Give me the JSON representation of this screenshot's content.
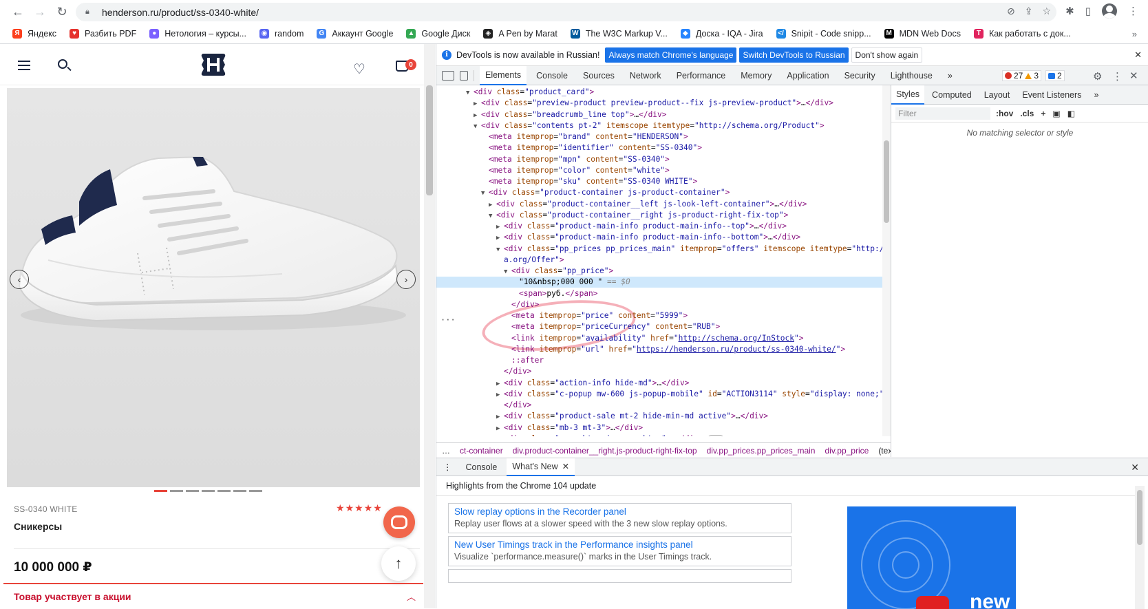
{
  "browser": {
    "url": "henderson.ru/product/ss-0340-white/",
    "bookmarks": [
      {
        "label": "Яндекс",
        "color": "#fc3f1d",
        "glyph": "Я"
      },
      {
        "label": "Разбить PDF",
        "color": "#e5322d",
        "glyph": "♥"
      },
      {
        "label": "Нетология – курсы...",
        "color": "#7b61ff",
        "glyph": "●"
      },
      {
        "label": "random",
        "color": "#5865f2",
        "glyph": "◉"
      },
      {
        "label": "Аккаунт Google",
        "color": "#4285f4",
        "glyph": "G"
      },
      {
        "label": "Google Диск",
        "color": "#34a853",
        "glyph": "▲"
      },
      {
        "label": "A Pen by Marat",
        "color": "#222222",
        "glyph": "◈"
      },
      {
        "label": "The W3C Markup V...",
        "color": "#005a9c",
        "glyph": "W"
      },
      {
        "label": "Доска - IQA - Jira",
        "color": "#2684ff",
        "glyph": "◆"
      },
      {
        "label": "Snipit - Code snipp...",
        "color": "#1e88e5",
        "glyph": "</"
      },
      {
        "label": "MDN Web Docs",
        "color": "#000000",
        "glyph": "M"
      },
      {
        "label": "Как работать с док...",
        "color": "#e0245e",
        "glyph": "T"
      }
    ]
  },
  "site": {
    "cart_count": "0",
    "sku": "SS-0340 WHITE",
    "product_type": "Сникерсы",
    "price": "10 000 000 ₽",
    "promo": "Товар участвует в акции",
    "rating": 4.5,
    "gallery_dots": 7,
    "gallery_active": 0
  },
  "devtools": {
    "info_message": "DevTools is now available in Russian!",
    "btn_match": "Always match Chrome's language",
    "btn_switch": "Switch DevTools to Russian",
    "btn_dismiss": "Don't show again",
    "tabs": [
      "Elements",
      "Console",
      "Sources",
      "Network",
      "Performance",
      "Memory",
      "Application",
      "Security",
      "Lighthouse"
    ],
    "errors": "27",
    "warnings": "3",
    "messages": "2",
    "breadcrumbs": [
      "ct-container",
      "div.product-container__right.js-product-right-fix-top",
      "div.pp_prices.pp_prices_main",
      "div.pp_price",
      "(text)"
    ],
    "styles_tabs": [
      "Styles",
      "Computed",
      "Layout",
      "Event Listeners"
    ],
    "filter_placeholder": "Filter",
    "hov": ":hov",
    "cls": ".cls",
    "no_match": "No matching selector or style",
    "drawer_tabs": [
      "Console",
      "What's New"
    ],
    "highlights": "Highlights from the Chrome 104 update",
    "cards": [
      {
        "title": "Slow replay options in the Recorder panel",
        "desc": "Replay user flows at a slower speed with the 3 new slow replay options."
      },
      {
        "title": "New User Timings track in the Performance insights panel",
        "desc": "Visualize `performance.measure()` marks in the User Timings track."
      }
    ],
    "video_text": "new"
  },
  "dom_lines": [
    {
      "indent": 3,
      "exp": "open",
      "html": "<span class=\"tg\">&lt;div</span> <span class=\"at\">class</span>=<span class=\"vl\">\"product_card\"</span><span class=\"tg\">&gt;</span>"
    },
    {
      "indent": 4,
      "exp": "closed",
      "html": "<span class=\"tg\">&lt;div</span> <span class=\"at\">class</span>=<span class=\"vl\">\"preview-product preview-product--fix js-preview-product\"</span><span class=\"tg\">&gt;</span>…<span class=\"tg\">&lt;/div&gt;</span>"
    },
    {
      "indent": 4,
      "exp": "closed",
      "html": "<span class=\"tg\">&lt;div</span> <span class=\"at\">class</span>=<span class=\"vl\">\"breadcrumb_line top\"</span><span class=\"tg\">&gt;</span>…<span class=\"tg\">&lt;/div&gt;</span>"
    },
    {
      "indent": 4,
      "exp": "open",
      "html": "<span class=\"tg\">&lt;div</span> <span class=\"at\">class</span>=<span class=\"vl\">\"contents pt-2\"</span> <span class=\"at\">itemscope</span> <span class=\"at\">itemtype</span>=<span class=\"vl\">\"http://schema.org/Product\"</span><span class=\"tg\">&gt;</span>"
    },
    {
      "indent": 5,
      "exp": "",
      "html": "<span class=\"tg\">&lt;meta</span> <span class=\"at\">itemprop</span>=<span class=\"vl\">\"brand\"</span> <span class=\"at\">content</span>=<span class=\"vl\">\"HENDERSON\"</span><span class=\"tg\">&gt;</span>"
    },
    {
      "indent": 5,
      "exp": "",
      "html": "<span class=\"tg\">&lt;meta</span> <span class=\"at\">itemprop</span>=<span class=\"vl\">\"identifier\"</span> <span class=\"at\">content</span>=<span class=\"vl\">\"SS-0340\"</span><span class=\"tg\">&gt;</span>"
    },
    {
      "indent": 5,
      "exp": "",
      "html": "<span class=\"tg\">&lt;meta</span> <span class=\"at\">itemprop</span>=<span class=\"vl\">\"mpn\"</span> <span class=\"at\">content</span>=<span class=\"vl\">\"SS-0340\"</span><span class=\"tg\">&gt;</span>"
    },
    {
      "indent": 5,
      "exp": "",
      "html": "<span class=\"tg\">&lt;meta</span> <span class=\"at\">itemprop</span>=<span class=\"vl\">\"color\"</span> <span class=\"at\">content</span>=<span class=\"vl\">\"white\"</span><span class=\"tg\">&gt;</span>"
    },
    {
      "indent": 5,
      "exp": "",
      "html": "<span class=\"tg\">&lt;meta</span> <span class=\"at\">itemprop</span>=<span class=\"vl\">\"sku\"</span> <span class=\"at\">content</span>=<span class=\"vl\">\"SS-0340 WHITE\"</span><span class=\"tg\">&gt;</span>"
    },
    {
      "indent": 5,
      "exp": "open",
      "html": "<span class=\"tg\">&lt;div</span> <span class=\"at\">class</span>=<span class=\"vl\">\"product-container js-product-container\"</span><span class=\"tg\">&gt;</span>"
    },
    {
      "indent": 6,
      "exp": "closed",
      "html": "<span class=\"tg\">&lt;div</span> <span class=\"at\">class</span>=<span class=\"vl\">\"product-container__left js-look-left-container\"</span><span class=\"tg\">&gt;</span>…<span class=\"tg\">&lt;/div&gt;</span>"
    },
    {
      "indent": 6,
      "exp": "open",
      "html": "<span class=\"tg\">&lt;div</span> <span class=\"at\">class</span>=<span class=\"vl\">\"product-container__right js-product-right-fix-top\"</span><span class=\"tg\">&gt;</span>"
    },
    {
      "indent": 7,
      "exp": "closed",
      "html": "<span class=\"tg\">&lt;div</span> <span class=\"at\">class</span>=<span class=\"vl\">\"product-main-info product-main-info--top\"</span><span class=\"tg\">&gt;</span>…<span class=\"tg\">&lt;/div&gt;</span>"
    },
    {
      "indent": 7,
      "exp": "closed",
      "html": "<span class=\"tg\">&lt;div</span> <span class=\"at\">class</span>=<span class=\"vl\">\"product-main-info product-main-info--bottom\"</span><span class=\"tg\">&gt;</span>…<span class=\"tg\">&lt;/div&gt;</span>"
    },
    {
      "indent": 7,
      "exp": "open",
      "html": "<span class=\"tg\">&lt;div</span> <span class=\"at\">class</span>=<span class=\"vl\">\"pp_prices pp_prices_main\"</span> <span class=\"at\">itemprop</span>=<span class=\"vl\">\"offers\"</span> <span class=\"at\">itemscope</span> <span class=\"at\">itemtype</span>=<span class=\"vl\">\"http://schem</span>"
    },
    {
      "indent": 7,
      "exp": "",
      "html": "<span class=\"vl\">a.org/Offer\"</span><span class=\"tg\">&gt;</span>"
    },
    {
      "indent": 8,
      "exp": "open",
      "html": "<span class=\"tg\">&lt;div</span> <span class=\"at\">class</span>=<span class=\"vl\">\"pp_price\"</span><span class=\"tg\">&gt;</span>"
    },
    {
      "indent": 9,
      "exp": "",
      "sel": true,
      "html": "<span class=\"tx\">\"10&amp;nbsp;000 000 \"</span> <span class=\"eq\">== $0</span>"
    },
    {
      "indent": 9,
      "exp": "",
      "html": "<span class=\"tg\">&lt;span&gt;</span><span class=\"tx\">руб.</span><span class=\"tg\">&lt;/span&gt;</span>"
    },
    {
      "indent": 8,
      "exp": "",
      "html": "<span class=\"tg\">&lt;/div&gt;</span>"
    },
    {
      "indent": 8,
      "exp": "",
      "html": "<span class=\"tg\">&lt;meta</span> <span class=\"at\">itemprop</span>=<span class=\"vl\">\"price\"</span> <span class=\"at\">content</span>=<span class=\"vl\">\"5999\"</span><span class=\"tg\">&gt;</span>"
    },
    {
      "indent": 8,
      "exp": "",
      "html": "<span class=\"tg\">&lt;meta</span> <span class=\"at\">itemprop</span>=<span class=\"vl\">\"priceCurrency\"</span> <span class=\"at\">content</span>=<span class=\"vl\">\"RUB\"</span><span class=\"tg\">&gt;</span>"
    },
    {
      "indent": 8,
      "exp": "",
      "html": "<span class=\"tg\">&lt;link</span> <span class=\"at\">itemprop</span>=<span class=\"vl\">\"availability\"</span> <span class=\"at\">href</span>=<span class=\"vl\">\"</span><span class=\"lnk\">http://schema.org/InStock</span><span class=\"vl\">\"</span><span class=\"tg\">&gt;</span>"
    },
    {
      "indent": 8,
      "exp": "",
      "html": "<span class=\"tg\">&lt;link</span> <span class=\"at\">itemprop</span>=<span class=\"vl\">\"url\"</span> <span class=\"at\">href</span>=<span class=\"vl\">\"</span><span class=\"lnk\">https://henderson.ru/product/ss-0340-white/</span><span class=\"vl\">\"</span><span class=\"tg\">&gt;</span>"
    },
    {
      "indent": 8,
      "exp": "",
      "html": "<span class=\"tg\">::after</span>"
    },
    {
      "indent": 7,
      "exp": "",
      "html": "<span class=\"tg\">&lt;/div&gt;</span>"
    },
    {
      "indent": 7,
      "exp": "closed",
      "html": "<span class=\"tg\">&lt;div</span> <span class=\"at\">class</span>=<span class=\"vl\">\"action-info hide-md\"</span><span class=\"tg\">&gt;</span>…<span class=\"tg\">&lt;/div&gt;</span>"
    },
    {
      "indent": 7,
      "exp": "closed",
      "html": "<span class=\"tg\">&lt;div</span> <span class=\"at\">class</span>=<span class=\"vl\">\"c-popup mw-600 js-popup-mobile\"</span> <span class=\"at\">id</span>=<span class=\"vl\">\"ACTION3114\"</span> <span class=\"at\">style</span>=<span class=\"vl\">\"display: none;\"</span><span class=\"tg\">&gt;</span>…"
    },
    {
      "indent": 7,
      "exp": "",
      "html": "<span class=\"tg\">&lt;/div&gt;</span>"
    },
    {
      "indent": 7,
      "exp": "closed",
      "html": "<span class=\"tg\">&lt;div</span> <span class=\"at\">class</span>=<span class=\"vl\">\"product-sale mt-2 hide-min-md active\"</span><span class=\"tg\">&gt;</span>…<span class=\"tg\">&lt;/div&gt;</span>"
    },
    {
      "indent": 7,
      "exp": "closed",
      "html": "<span class=\"tg\">&lt;div</span> <span class=\"at\">class</span>=<span class=\"vl\">\"mb-3 mt-3\"</span><span class=\"tg\">&gt;</span>…<span class=\"tg\">&lt;/div&gt;</span>"
    },
    {
      "indent": 7,
      "exp": "closed",
      "html": "<span class=\"tg\">&lt;div</span> <span class=\"at\">class</span>=<span class=\"vl\">\"wrap-btns js-wrap-btns\"</span><span class=\"tg\">&gt;</span>…<span class=\"tg\">&lt;/div&gt;</span> <span class=\"flex-badge\">flex</span>"
    }
  ]
}
